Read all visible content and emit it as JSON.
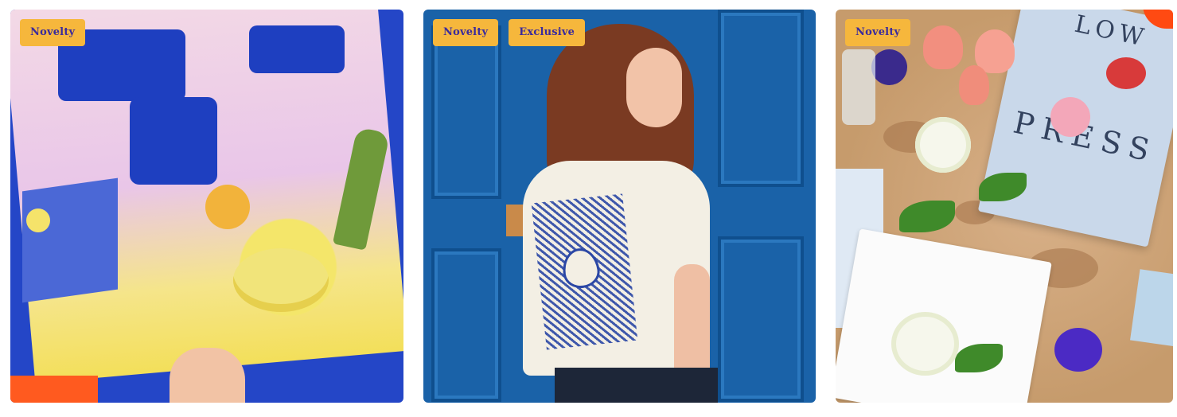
{
  "cards": [
    {
      "badges": [
        "Novelty"
      ],
      "image_alt": "Colorful jigsaw puzzle of a still life being assembled"
    },
    {
      "badges": [
        "Novelty",
        "Exclusive"
      ],
      "image_alt": "Woman wearing a cream t-shirt with blue doodle print in front of a blue door"
    },
    {
      "badges": [
        "Novelty"
      ],
      "image_alt": "Flower press box with fresh flowers on a wooden table",
      "box_text": [
        "LOW",
        "PRESS"
      ]
    }
  ],
  "colors": {
    "badge_bg": "#f6b73c",
    "badge_text": "#3a2a9c",
    "accent_orange": "#ff4a12"
  }
}
